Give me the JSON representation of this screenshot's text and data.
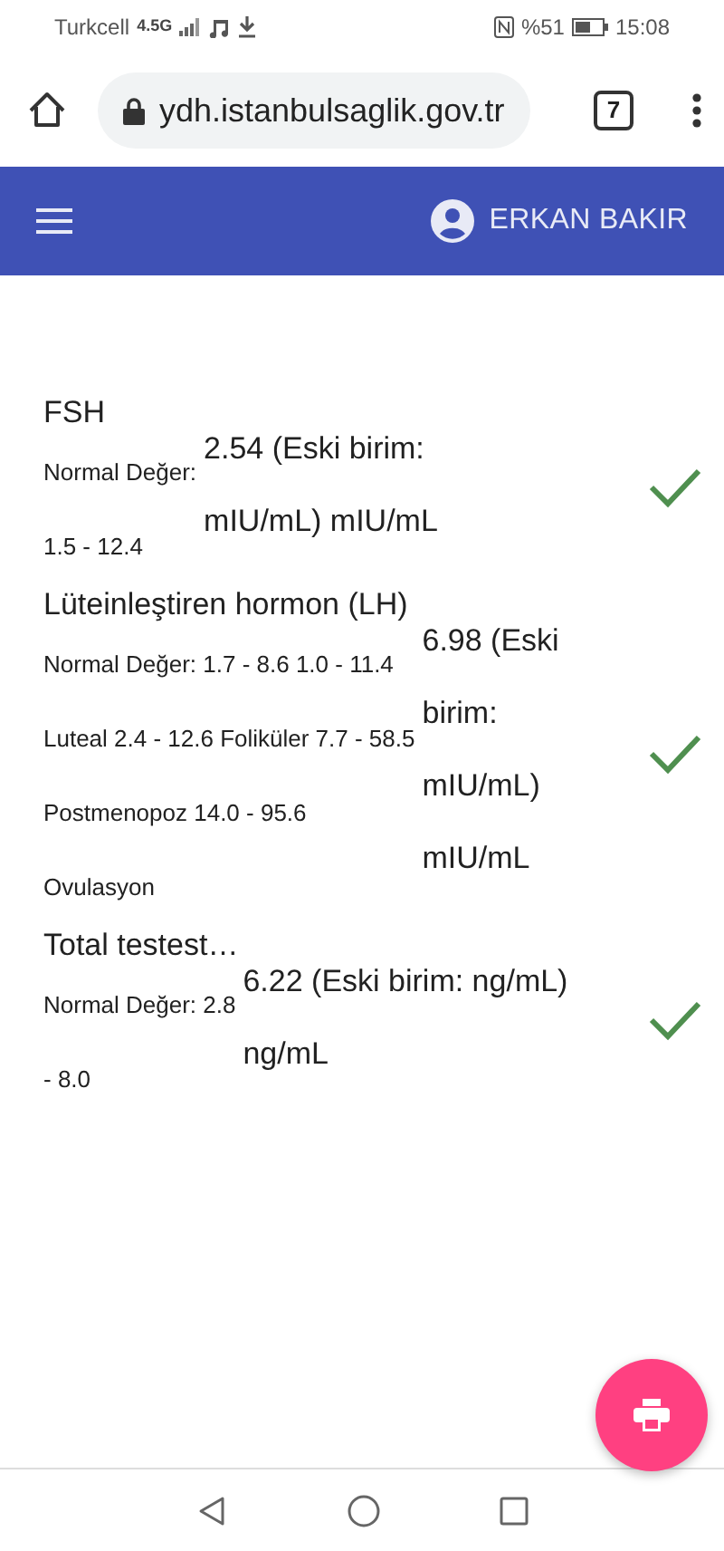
{
  "status_bar": {
    "carrier": "Turkcell",
    "network": "4.5G",
    "battery": "%51",
    "time": "15:08"
  },
  "browser": {
    "url": "ydh.istanbulsaglik.gov.tr",
    "tab_count": "7"
  },
  "header": {
    "user": "ERKAN BAKIR"
  },
  "results": [
    {
      "title": "FSH",
      "range_lines": [
        "Normal Değer:",
        "1.5 - 12.4"
      ],
      "value_lines": [
        "2.54 (Eski birim:",
        "mIU/mL) mIU/mL"
      ],
      "normal": true
    },
    {
      "title": "Lüteinleştiren hormon (LH)",
      "range_lines": [
        "Normal Değer: 1.7 - 8.6 1.0 - 11.4",
        "Luteal 2.4 - 12.6 Foliküler 7.7 - 58.5",
        "Postmenopoz 14.0 - 95.6",
        "Ovulasyon"
      ],
      "value_lines": [
        "6.98 (Eski",
        "birim:",
        "mIU/mL)",
        "mIU/mL"
      ],
      "normal": true
    },
    {
      "title": "Total testest…",
      "range_lines": [
        "Normal Değer: 2.8",
        "- 8.0"
      ],
      "value_lines": [
        "6.22 (Eski birim: ng/mL)",
        "ng/mL"
      ],
      "normal": true
    }
  ]
}
